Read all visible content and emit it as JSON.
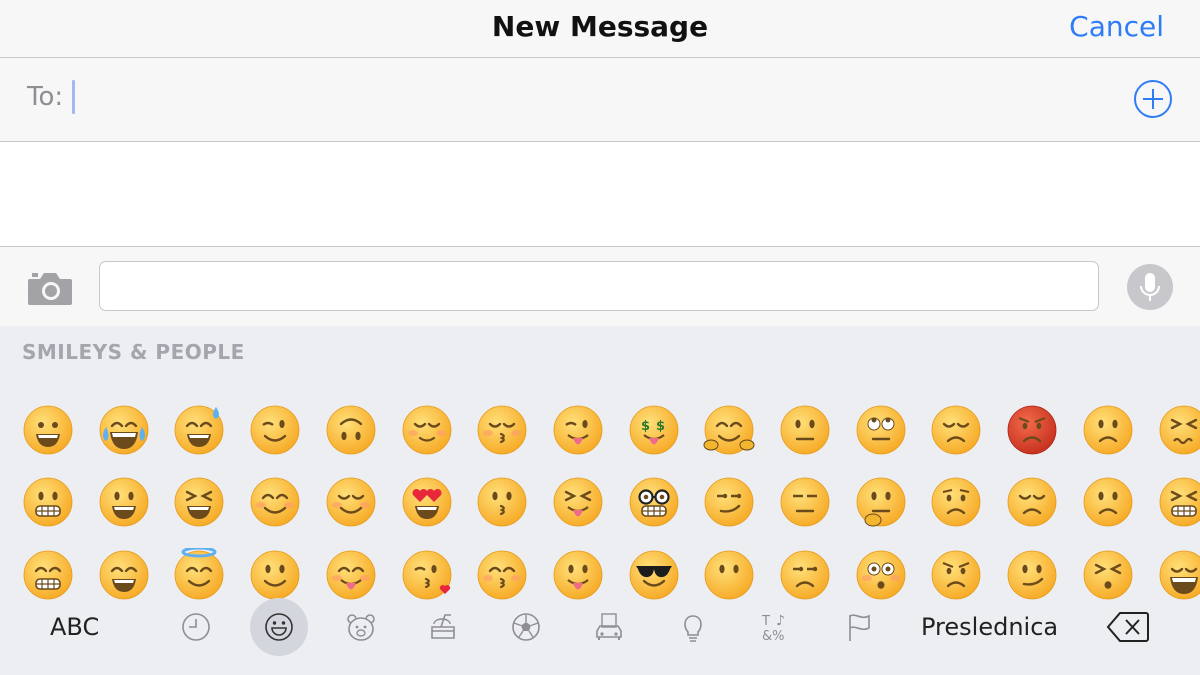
{
  "nav": {
    "title": "New Message",
    "cancel_label": "Cancel"
  },
  "to_field": {
    "label": "To:",
    "value": "",
    "add_icon": "plus-circle-icon"
  },
  "message_bar": {
    "camera_icon": "camera-icon",
    "message_value": "",
    "mic_icon": "microphone-icon"
  },
  "keyboard": {
    "section_title": "SMILEYS & PEOPLE",
    "emoji_rows": [
      [
        "grinning-face",
        "face-with-tears-of-joy",
        "smiling-face-with-open-mouth-and-cold-sweat",
        "winking-face",
        "upside-down-face",
        "relieved-face",
        "kissing-face-with-closed-eyes",
        "face-with-stuck-out-tongue-and-winking-eye",
        "money-mouth-face",
        "hugging-face",
        "neutral-face",
        "face-with-rolling-eyes",
        "disappointed-face",
        "pouting-face",
        "slightly-frowning-face",
        "confounded-face"
      ],
      [
        "grimacing-face",
        "smiling-face-with-open-mouth",
        "smiling-face-with-open-mouth-and-tightly-closed-eyes",
        "smiling-face-with-smiling-eyes",
        "smiling-face",
        "smiling-face-with-heart-shaped-eyes",
        "kissing-face",
        "face-with-stuck-out-tongue-and-tightly-closed-eyes",
        "nerd-face",
        "smirking-face",
        "expressionless-face",
        "thinking-face",
        "worried-face",
        "pensive-face",
        "frowning-face",
        "persevering-face"
      ],
      [
        "grinning-face-with-smiling-eyes",
        "smiling-face-with-open-mouth-and-smiling-eyes",
        "smiling-face-with-halo",
        "slightly-smiling-face",
        "face-savouring-delicious-food",
        "face-throwing-a-kiss",
        "kissing-face-with-smiling-eyes",
        "face-with-stuck-out-tongue",
        "smiling-face-with-sunglasses",
        "face-without-mouth",
        "unamused-face",
        "flushed-face",
        "angry-face",
        "confused-face",
        "tired-face",
        "weary-face"
      ]
    ],
    "abc_label": "ABC",
    "category_icons": [
      "clock-icon",
      "smiley-icon",
      "bear-icon",
      "food-icon",
      "soccer-ball-icon",
      "building-icon",
      "lightbulb-icon",
      "symbols-icon",
      "flag-icon"
    ],
    "active_category": "smiley-icon",
    "space_label": "Preslednica",
    "delete_icon": "delete-icon"
  },
  "colors": {
    "accent": "#2f7df6",
    "keyboard_bg": "#eceef1",
    "emoji_yellow": "#ffc83d",
    "angry_red": "#e8432c"
  }
}
